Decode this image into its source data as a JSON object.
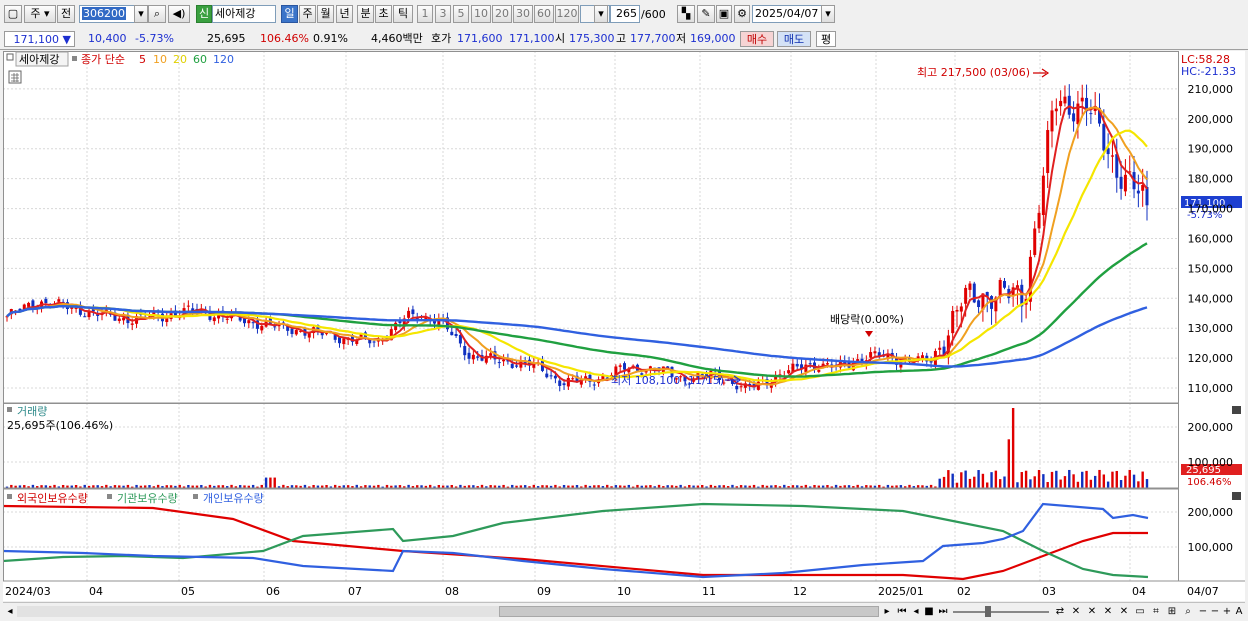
{
  "toolbar": {
    "sel1": "주",
    "sel2": "전",
    "code": "306200",
    "badge": "신",
    "name": "세아제강",
    "periods": [
      "일",
      "주",
      "월",
      "년",
      "분",
      "초",
      "틱"
    ],
    "minutes": [
      "1",
      "3",
      "5",
      "10",
      "20",
      "30",
      "60",
      "120"
    ],
    "count": "265",
    "count_total": "/600",
    "date": "2025/04/07"
  },
  "quote": {
    "price": "171,100",
    "change": "10,400",
    "rate": "-5.73%",
    "volume": "25,695",
    "vol_rate": "106.46%",
    "turnover": "0.91%",
    "amount": "4,460백만",
    "hoga_label": "호가",
    "ask": "171,600",
    "bid": "171,100",
    "open_label": "시",
    "open": "175,300",
    "high_label": "고",
    "high": "177,700",
    "low_label": "저",
    "low": "169,000",
    "buy": "매수",
    "sell": "매도",
    "avg": "평"
  },
  "price_panel": {
    "name_tab": "세아제강",
    "legend_prefix": "종가 단순",
    "ma": [
      "5",
      "10",
      "20",
      "60",
      "120"
    ],
    "lc": "LC:58.28",
    "hc": "HC:-21.33",
    "high_note": "최고 217,500 (03/06)",
    "low_note": "최저 108,100 (11/15)",
    "dividend_note": "배당락(0.00%)",
    "current_price": "171,100",
    "current_rate": "-5.73%",
    "y_ticks": [
      "210,000",
      "200,000",
      "190,000",
      "180,000",
      "170,000",
      "160,000",
      "150,000",
      "140,000",
      "130,000",
      "120,000",
      "110,000"
    ]
  },
  "volume_panel": {
    "title": "거래량",
    "info": "25,695주(106.46%)",
    "y_ticks": [
      "200,000",
      "100,000"
    ],
    "current": "25,695",
    "current_rate": "106.46%"
  },
  "holding_panel": {
    "series": [
      "외국인보유수량",
      "기관보유수량",
      "개인보유수량"
    ],
    "y_ticks": [
      "200,000",
      "100,000"
    ]
  },
  "x_axis": [
    "2024/03",
    "04",
    "05",
    "06",
    "07",
    "08",
    "09",
    "10",
    "11",
    "12",
    "2025/01",
    "02",
    "03",
    "04",
    "04/07"
  ],
  "colors": {
    "ma5": "#e02020",
    "ma10": "#f0a020",
    "ma20": "#f5e600",
    "ma60": "#20a040",
    "ma120": "#3060e0",
    "up": "#e00000",
    "down": "#1030c0",
    "foreign": "#e00000",
    "institution": "#2e9a5a",
    "individual": "#3060e0"
  },
  "chart_data": {
    "type": "candlestick",
    "period": "daily",
    "dates": [
      "03/04",
      "03/14",
      "03/25",
      "04/04",
      "04/15",
      "04/25",
      "05/07",
      "05/17",
      "05/28",
      "06/07",
      "06/18",
      "06/28",
      "07/09",
      "07/19",
      "07/30",
      "08/09",
      "08/20",
      "08/30",
      "09/10",
      "09/23",
      "10/04",
      "10/15",
      "10/25",
      "11/05",
      "11/15",
      "11/26",
      "12/06",
      "12/17",
      "12/27",
      "01/08",
      "01/20",
      "01/31",
      "02/11",
      "02/21",
      "03/05",
      "03/17",
      "03/27",
      "04/07"
    ],
    "close": [
      134000,
      139000,
      137000,
      134500,
      133000,
      134000,
      136000,
      134000,
      132000,
      130000,
      128500,
      126500,
      125500,
      134000,
      133000,
      121000,
      119000,
      118000,
      112000,
      112500,
      116500,
      116500,
      113000,
      114500,
      109500,
      114000,
      118000,
      117000,
      121000,
      119500,
      119000,
      139000,
      142000,
      140000,
      205000,
      205000,
      184000,
      171100
    ],
    "ylim": [
      105000,
      220000
    ],
    "high_label": {
      "value": 217500,
      "date": "03/06"
    },
    "low_label": {
      "value": 108100,
      "date": "11/15"
    }
  }
}
